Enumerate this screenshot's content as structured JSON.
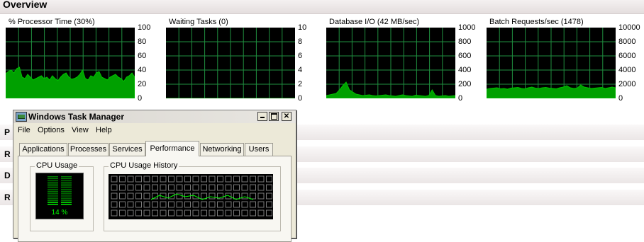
{
  "overview": {
    "title": "Overview"
  },
  "graphs": [
    {
      "title": "% Processor Time (30%)",
      "ticks": [
        "100",
        "80",
        "60",
        "40",
        "20",
        "0"
      ],
      "max": 100,
      "values": [
        35,
        38,
        40,
        36,
        42,
        44,
        30,
        28,
        34,
        30,
        26,
        28,
        30,
        32,
        28,
        30,
        26,
        32,
        28,
        25,
        30,
        34,
        36,
        30,
        27,
        28,
        30,
        34,
        40,
        28,
        26,
        32,
        30,
        36,
        38,
        30,
        28,
        26,
        30,
        32,
        34,
        30,
        28,
        24,
        30,
        32,
        36,
        30
      ]
    },
    {
      "title": "Waiting Tasks (0)",
      "ticks": [
        "10",
        "8",
        "6",
        "4",
        "2",
        "0"
      ],
      "max": 10,
      "values": [
        0,
        0,
        0,
        0,
        0,
        0,
        0,
        0,
        0,
        0,
        0,
        0,
        0,
        0,
        0,
        0,
        0,
        0,
        0,
        0
      ]
    },
    {
      "title": "Database I/O (42 MB/sec)",
      "ticks": [
        "1000",
        "800",
        "600",
        "400",
        "200",
        "0"
      ],
      "max": 1000,
      "values": [
        40,
        50,
        60,
        70,
        120,
        180,
        230,
        120,
        90,
        60,
        50,
        40,
        45,
        50,
        40,
        35,
        40,
        45,
        50,
        40,
        35,
        30,
        40,
        50,
        40,
        35,
        30,
        45,
        40,
        35,
        30,
        40,
        120,
        40,
        30,
        35,
        40,
        30,
        35,
        40
      ]
    },
    {
      "title": "Batch Requests/sec (1478)",
      "ticks": [
        "10000",
        "8000",
        "6000",
        "4000",
        "2000",
        "0"
      ],
      "max": 10000,
      "values": [
        1300,
        1400,
        1450,
        1500,
        1350,
        1400,
        1300,
        1450,
        1500,
        1550,
        1400,
        1350,
        1500,
        1600,
        1450,
        1400,
        1500,
        1550,
        1450,
        1400,
        1350,
        1500,
        1600,
        1800,
        1500,
        1400,
        1450,
        1900,
        1600,
        1500,
        1400,
        1450,
        1500,
        1550,
        1400,
        1500,
        1600,
        1500
      ]
    }
  ],
  "sections": [
    "P",
    "R",
    "D",
    "R"
  ],
  "taskmanager": {
    "title": "Windows Task Manager",
    "menu": [
      "File",
      "Options",
      "View",
      "Help"
    ],
    "tabs": [
      "Applications",
      "Processes",
      "Services",
      "Performance",
      "Networking",
      "Users"
    ],
    "active_tab": "Performance",
    "cpu_usage_label": "CPU Usage",
    "cpu_usage_value": "14 %",
    "cpu_usage_level": 0.14,
    "cpu_history_label": "CPU Usage History"
  },
  "colors": {
    "graph_line": "#00c000",
    "graph_fill": "#00a000",
    "graph_grid": "#1f8f3f"
  }
}
